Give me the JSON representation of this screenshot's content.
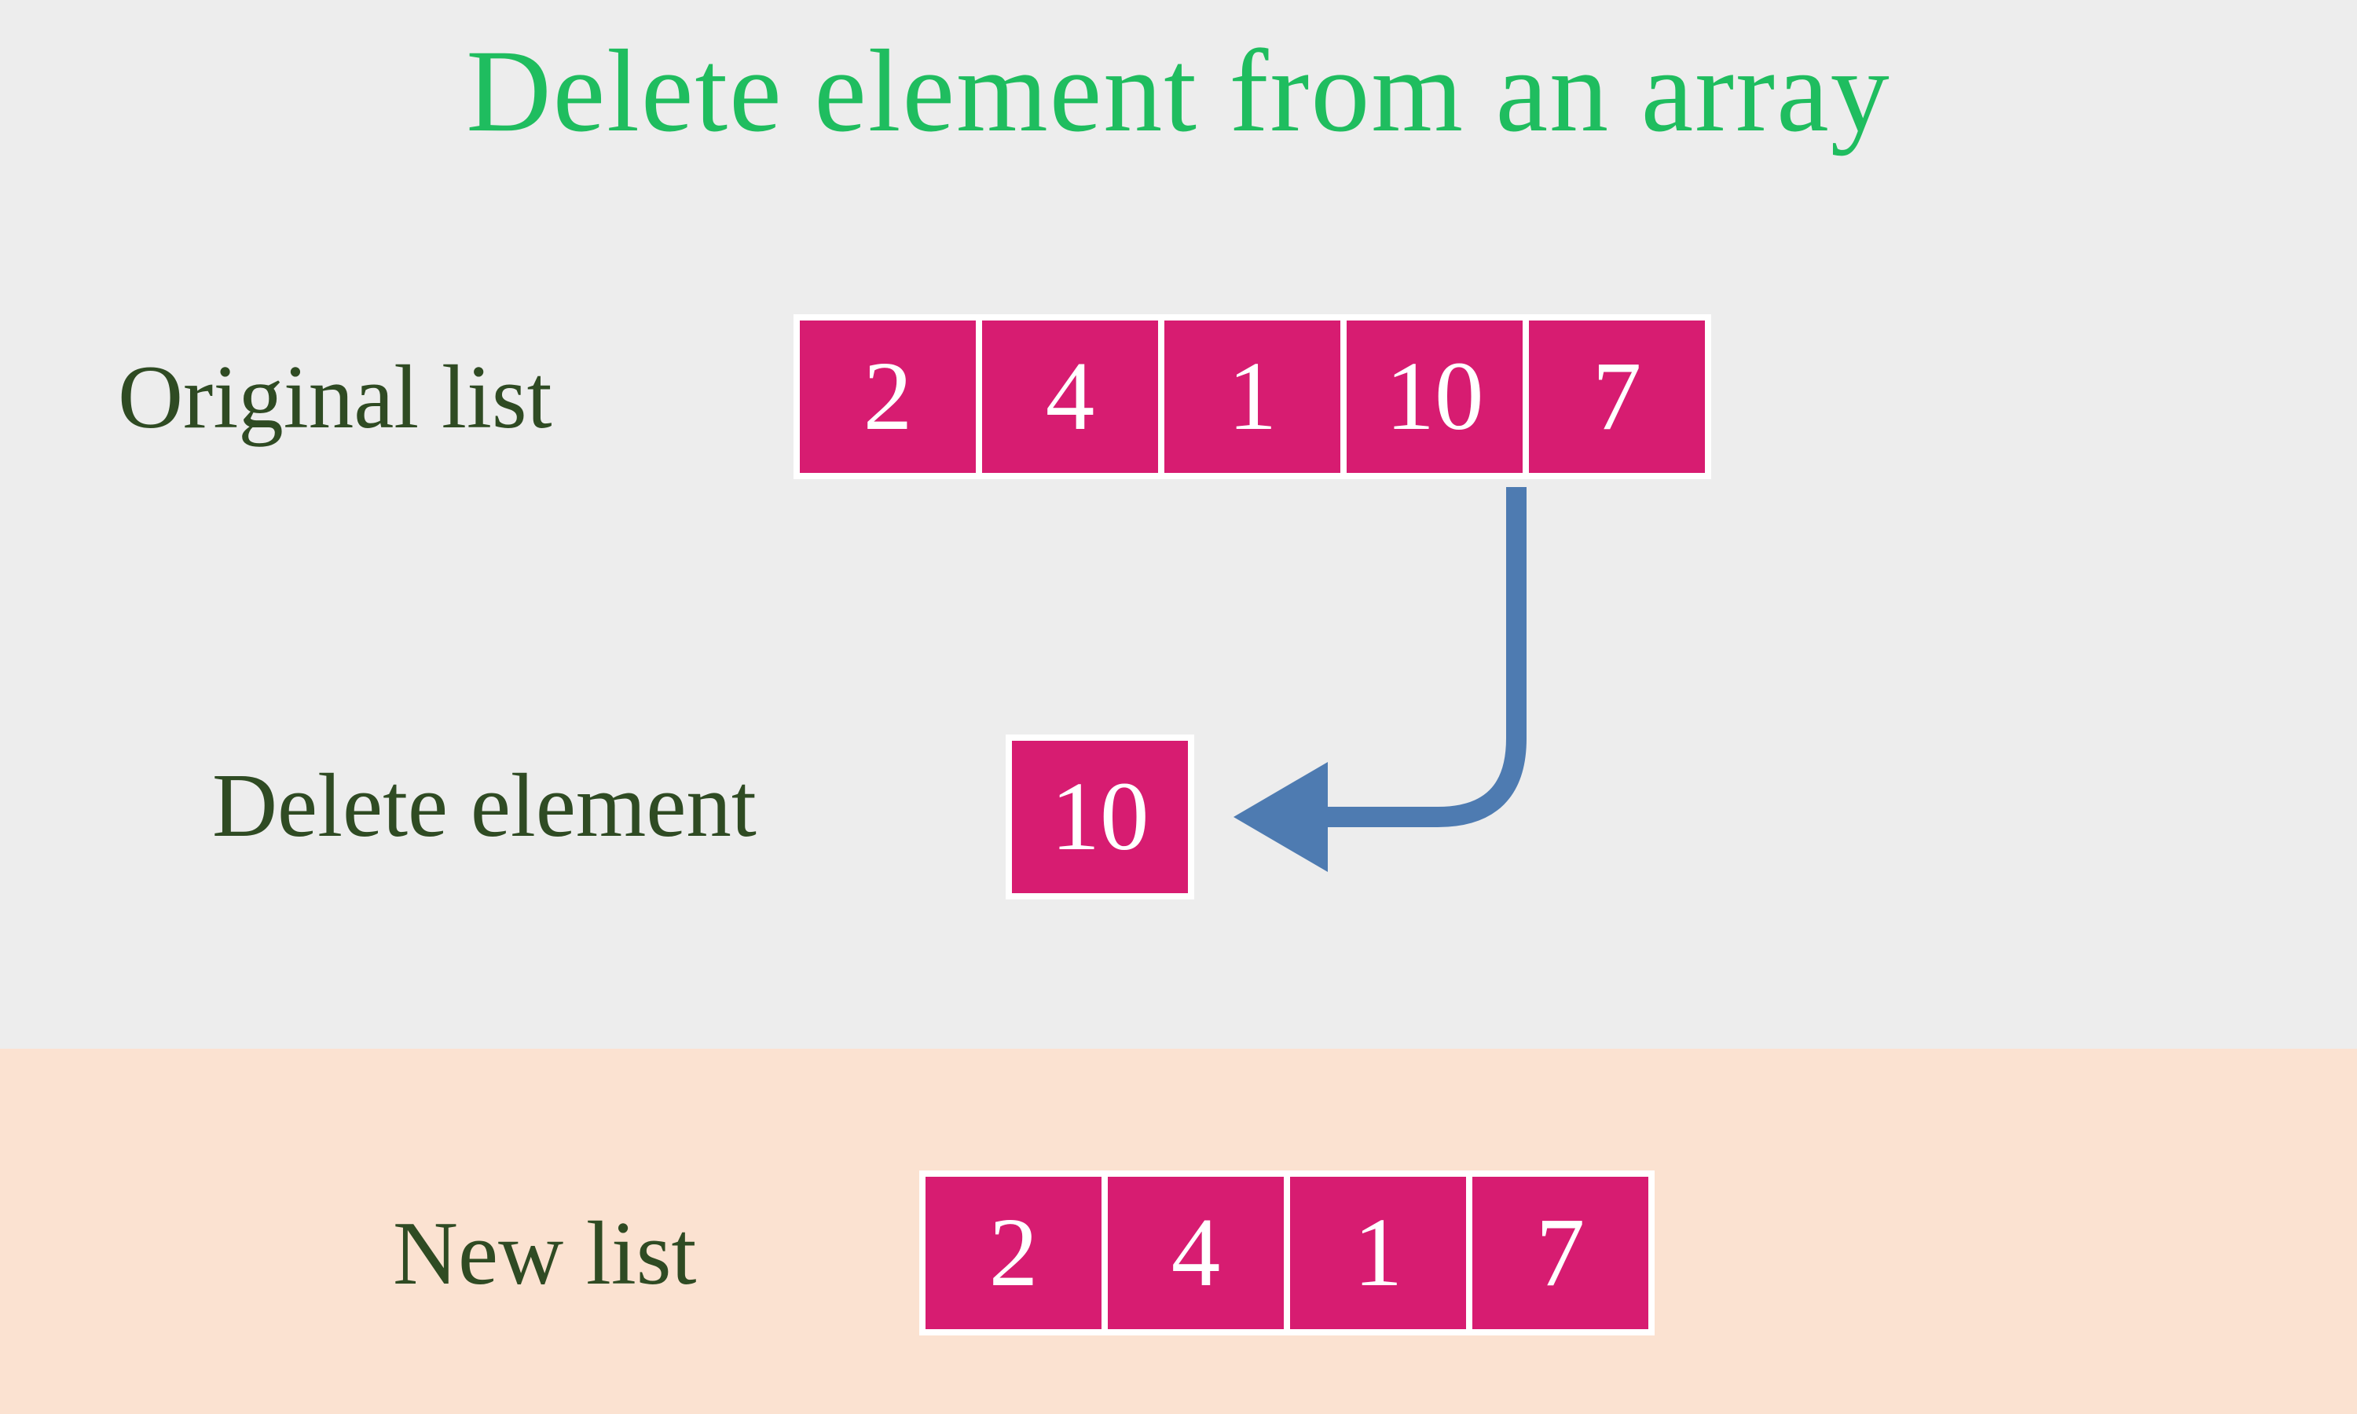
{
  "title": "Delete element from an array",
  "labels": {
    "original": "Original list",
    "delete": "Delete element",
    "newlist": "New list"
  },
  "original_list": [
    2,
    4,
    1,
    10,
    7
  ],
  "delete_element": 10,
  "new_list": [
    2,
    4,
    1,
    7
  ],
  "colors": {
    "title": "#1fbd5f",
    "label": "#2f4b23",
    "cell_bg": "#d71c71",
    "cell_fg": "#ffffff",
    "band": "#fbe2d1",
    "arrow": "#4e7bb1",
    "page_bg": "#ededed"
  }
}
